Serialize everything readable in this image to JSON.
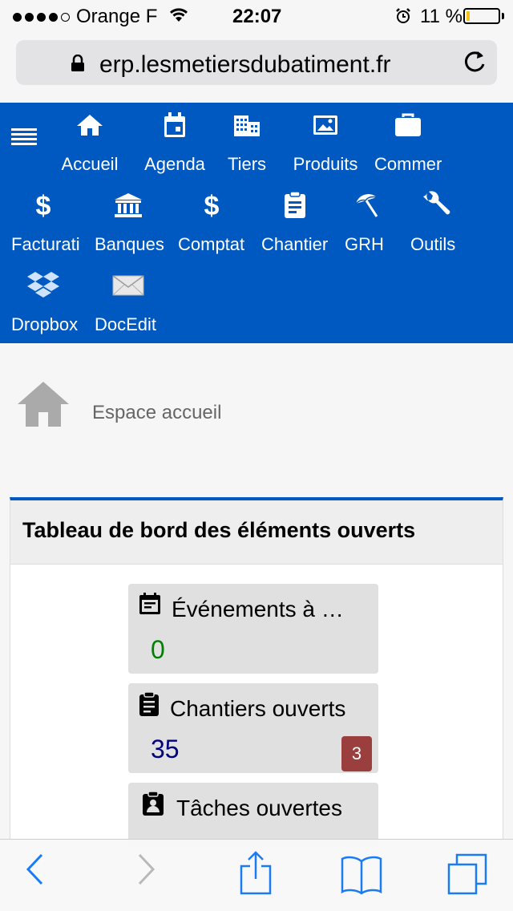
{
  "status_bar": {
    "carrier": "Orange F",
    "time": "22:07",
    "battery_percent": "11 %",
    "battery_level": 0.11
  },
  "browser": {
    "url": "erp.lesmetiersdubatiment.fr"
  },
  "nav": {
    "items": [
      {
        "label": "Accueil",
        "icon": "home-icon"
      },
      {
        "label": "Agenda",
        "icon": "calendar-icon"
      },
      {
        "label": "Tiers",
        "icon": "building-icon"
      },
      {
        "label": "Produits",
        "icon": "image-icon"
      },
      {
        "label": "Commer",
        "icon": "briefcase-icon"
      },
      {
        "label": "Facturati",
        "icon": "dollar-icon"
      },
      {
        "label": "Banques",
        "icon": "bank-icon"
      },
      {
        "label": "Comptat",
        "icon": "dollar-icon"
      },
      {
        "label": "Chantier",
        "icon": "clipboard-icon"
      },
      {
        "label": "GRH",
        "icon": "beach-umbrella-icon"
      },
      {
        "label": "Outils",
        "icon": "wrench-icon"
      },
      {
        "label": "Dropbox",
        "icon": "dropbox-icon"
      },
      {
        "label": "DocEdit",
        "icon": "envelope-icon"
      }
    ]
  },
  "breadcrumb": {
    "title": "Espace accueil"
  },
  "dashboard": {
    "title": "Tableau de bord des éléments ouverts",
    "cards": [
      {
        "label": "Événements à …",
        "value": "0",
        "value_color": "#008000",
        "badge": "",
        "icon": "calendar-event-icon"
      },
      {
        "label": "Chantiers ouverts",
        "value": "35",
        "value_color": "#000080",
        "badge": "3",
        "icon": "clipboard-icon"
      },
      {
        "label": "Tâches ouvertes",
        "value": "",
        "value_color": "#000080",
        "badge": "",
        "icon": "task-icon"
      }
    ]
  },
  "colors": {
    "nav_bg": "#0059c1",
    "badge_bg": "#9a3e3e",
    "ios_blue": "#1a7cf5"
  }
}
